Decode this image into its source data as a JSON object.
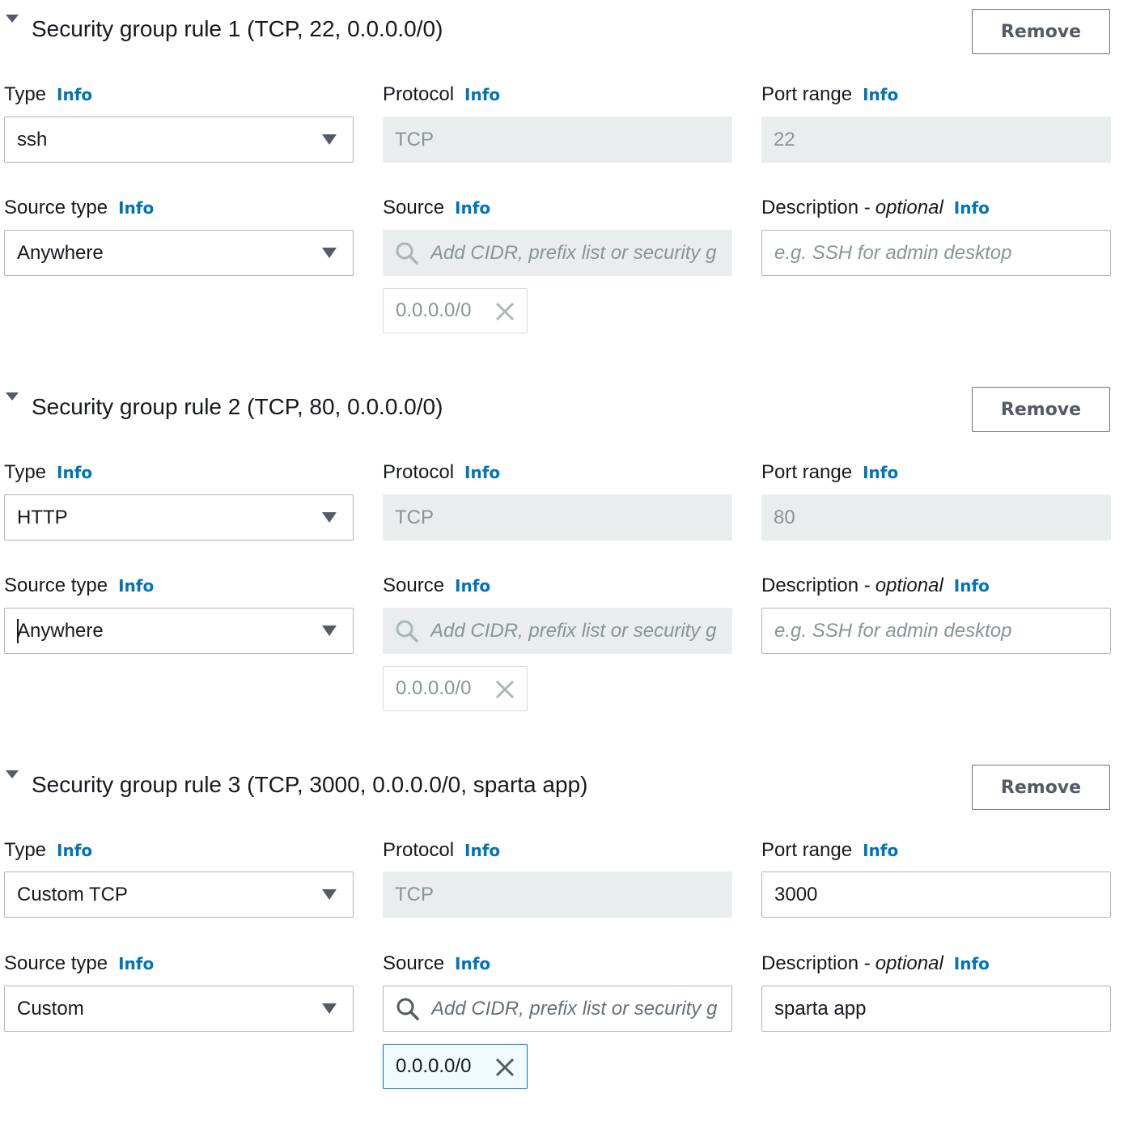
{
  "labels": {
    "type": "Type",
    "protocol": "Protocol",
    "port_range": "Port range",
    "source_type": "Source type",
    "source": "Source",
    "description": "Description -",
    "optional": "optional",
    "info": "Info",
    "remove": "Remove",
    "source_placeholder": "Add CIDR, prefix list or security g",
    "description_placeholder": "e.g. SSH for admin desktop"
  },
  "rules": [
    {
      "title": "Security group rule 1 (TCP, 22, 0.0.0.0/0)",
      "type": "ssh",
      "protocol": "TCP",
      "port_range": "22",
      "source_type": "Anywhere",
      "source_token": "0.0.0.0/0",
      "description": ""
    },
    {
      "title": "Security group rule 2 (TCP, 80, 0.0.0.0/0)",
      "type": "HTTP",
      "protocol": "TCP",
      "port_range": "80",
      "source_type": "Anywhere",
      "source_token": "0.0.0.0/0",
      "description": ""
    },
    {
      "title": "Security group rule 3 (TCP, 3000, 0.0.0.0/0, sparta app)",
      "type": "Custom TCP",
      "protocol": "TCP",
      "port_range": "3000",
      "source_type": "Custom",
      "source_token": "0.0.0.0/0",
      "description": "sparta app"
    }
  ],
  "colors": {
    "info_link": "#0073bb",
    "disabled_bg": "#eaeded",
    "input_border": "#aab7b8",
    "token_active_border": "#0073bb"
  },
  "icons": [
    "caret-down-icon",
    "search-icon",
    "close-icon"
  ]
}
